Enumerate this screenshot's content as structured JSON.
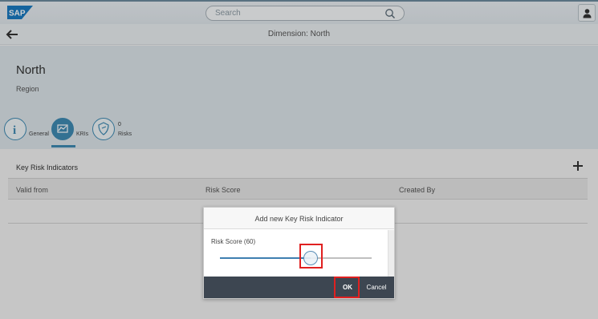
{
  "shell": {
    "logo_text": "SAP",
    "search_placeholder": "Search",
    "icons": {
      "search": "search-icon",
      "user": "user-icon"
    }
  },
  "nav": {
    "title": "Dimension: North",
    "back_icon": "back-arrow-icon"
  },
  "object": {
    "title": "North",
    "subtitle": "Region",
    "tabs": [
      {
        "label": "General",
        "icon": "info-icon",
        "selected": false
      },
      {
        "label": "KRIs",
        "icon": "kri-chart-icon",
        "selected": true
      },
      {
        "label": "Risks",
        "icon": "risk-shield-icon",
        "count": "0",
        "selected": false
      }
    ]
  },
  "table": {
    "title": "Key Risk Indicators",
    "add_icon": "add-icon",
    "columns": [
      "Valid from",
      "Risk Score",
      "Created By"
    ]
  },
  "dialog": {
    "title": "Add new Key Risk Indicator",
    "slider_label": "Risk Score (60)",
    "slider_value": 60,
    "slider_max": 100,
    "ok_label": "OK",
    "cancel_label": "Cancel"
  },
  "colors": {
    "accent": "#3f8ab3",
    "highlight": "#e02020",
    "dialog_footer": "#3d4651"
  }
}
